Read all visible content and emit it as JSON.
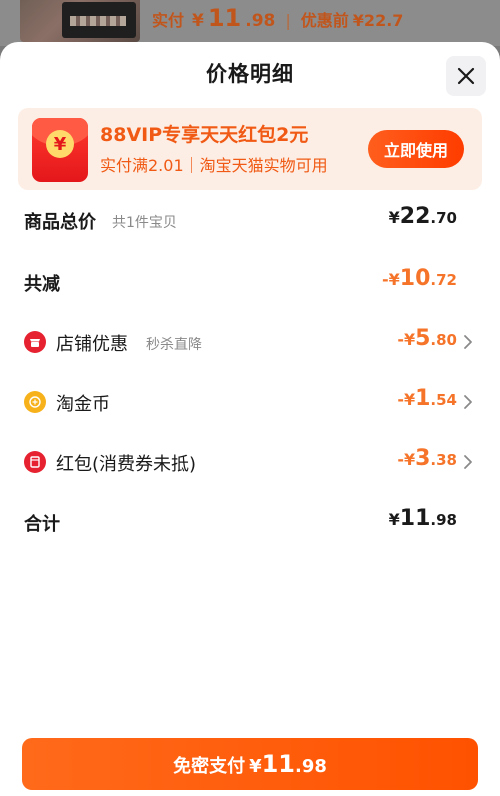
{
  "colors": {
    "accent": "#ff5a00",
    "discount": "#f5742a",
    "promo_bg": "#fdeee5",
    "text": "#1a1a1a"
  },
  "background_summary": {
    "paid_label": "实付",
    "currency": "¥",
    "paid_int": "11",
    "paid_dec": ".98",
    "separator": "|",
    "original_label": "优惠前",
    "original_price": "¥22.7"
  },
  "sheet": {
    "title": "价格明细",
    "close_icon": "close-icon"
  },
  "promo": {
    "icon": "red-envelope-icon",
    "icon_glyph": "¥",
    "title": "88VIP专享天天红包2元",
    "subtitle": "实付满2.01｜淘宝天猫实物可用",
    "button": "立即使用"
  },
  "rows": {
    "total": {
      "label": "商品总价",
      "hint": "共1件宝贝",
      "sym": "¥",
      "int": "22",
      "dec": ".70"
    },
    "reduced": {
      "label": "共减",
      "sym": "-¥",
      "int": "10",
      "dec": ".72"
    },
    "shop": {
      "icon": "shop-icon",
      "label": "店铺优惠",
      "hint": "秒杀直降",
      "sym": "-¥",
      "int": "5",
      "dec": ".80"
    },
    "coins": {
      "icon": "gold-coin-icon",
      "label": "淘金币",
      "sym": "-¥",
      "int": "1",
      "dec": ".54"
    },
    "envelope": {
      "icon": "red-packet-icon",
      "label": "红包(消费券未抵)",
      "sym": "-¥",
      "int": "3",
      "dec": ".38"
    },
    "sum": {
      "label": "合计",
      "sym": "¥",
      "int": "11",
      "dec": ".98"
    }
  },
  "pay_button": {
    "label": "免密支付",
    "sym": "¥",
    "int": "11",
    "dec": ".98"
  }
}
